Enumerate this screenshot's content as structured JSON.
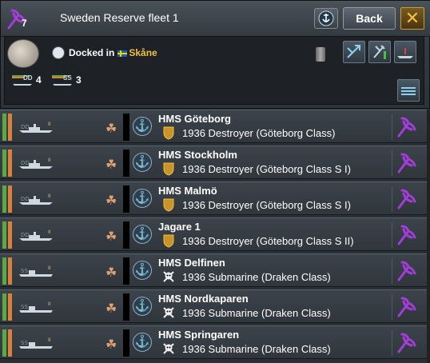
{
  "header": {
    "fleet_count": "7",
    "title": "Sweden Reserve fleet 1",
    "back_label": "Back",
    "close_symbol": "✕"
  },
  "status": {
    "location_prefix": "Docked in",
    "location_name": "Skåne",
    "dd_count": "4",
    "ss_count": "3",
    "dd_label": "DD",
    "ss_label": "SS"
  },
  "colors": {
    "accent_purple": "#9b2fc8",
    "strength_green": "#5ca845",
    "org_orange": "#d9803a",
    "location_gold": "#f0c040"
  },
  "ships": [
    {
      "name": "HMS Göteborg",
      "type": "1936 Destroyer (Göteborg Class)",
      "class_code": "DD",
      "kind": "destroyer"
    },
    {
      "name": "HMS Stockholm",
      "type": "1936 Destroyer (Göteborg Class S I)",
      "class_code": "DD",
      "kind": "destroyer"
    },
    {
      "name": "HMS Malmö",
      "type": "1936 Destroyer (Göteborg Class S I)",
      "class_code": "DD",
      "kind": "destroyer"
    },
    {
      "name": "Jagare 1",
      "type": "1936 Destroyer (Göteborg Class S II)",
      "class_code": "DD",
      "kind": "destroyer"
    },
    {
      "name": "HMS Delfinen",
      "type": "1936 Submarine (Draken Class)",
      "class_code": "SS",
      "kind": "submarine"
    },
    {
      "name": "HMS Nordkaparen",
      "type": "1936 Submarine (Draken Class)",
      "class_code": "SS",
      "kind": "submarine"
    },
    {
      "name": "HMS Springaren",
      "type": "1936 Submarine (Draken Class)",
      "class_code": "SS",
      "kind": "submarine"
    }
  ],
  "icons": {
    "fleet": "trident-icon",
    "anchor": "anchor-icon",
    "clover": "clover-icon",
    "fuel": "fuel-barrel-icon",
    "destroyer_role": "gold-shield-icon",
    "submarine_role": "skull-crossbones-icon",
    "select": "trident-icon"
  }
}
